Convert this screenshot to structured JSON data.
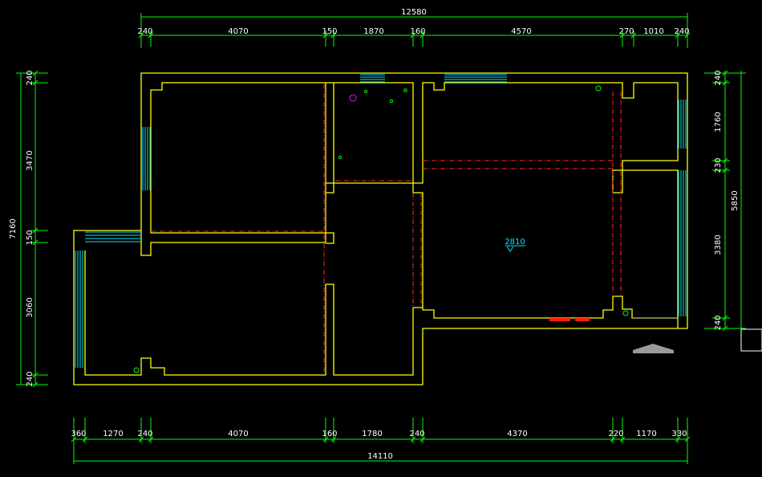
{
  "dimensions": {
    "top_total": "12580",
    "top_segments": [
      "240",
      "4070",
      "150",
      "1870",
      "160",
      "4570",
      "270",
      "1010",
      "240"
    ],
    "bottom_total": "14110",
    "bottom_segments": [
      "360",
      "1270",
      "240",
      "4070",
      "160",
      "1780",
      "240",
      "4370",
      "220",
      "1170",
      "330"
    ],
    "left_total": "7160",
    "left_segments": [
      "240",
      "3470",
      "150",
      "3060",
      "240"
    ],
    "right_total": "5850",
    "right_segments": [
      "240",
      "1760",
      "230",
      "3380",
      "240"
    ]
  },
  "elevation_mark": "2810",
  "colors": {
    "walls": "#ffff00",
    "dimension_lines": "#00ff00",
    "windows": "#00e5ff",
    "hidden_lines": "#ff2a2a",
    "fixtures": "#ff2200",
    "text": "#ffffff"
  }
}
